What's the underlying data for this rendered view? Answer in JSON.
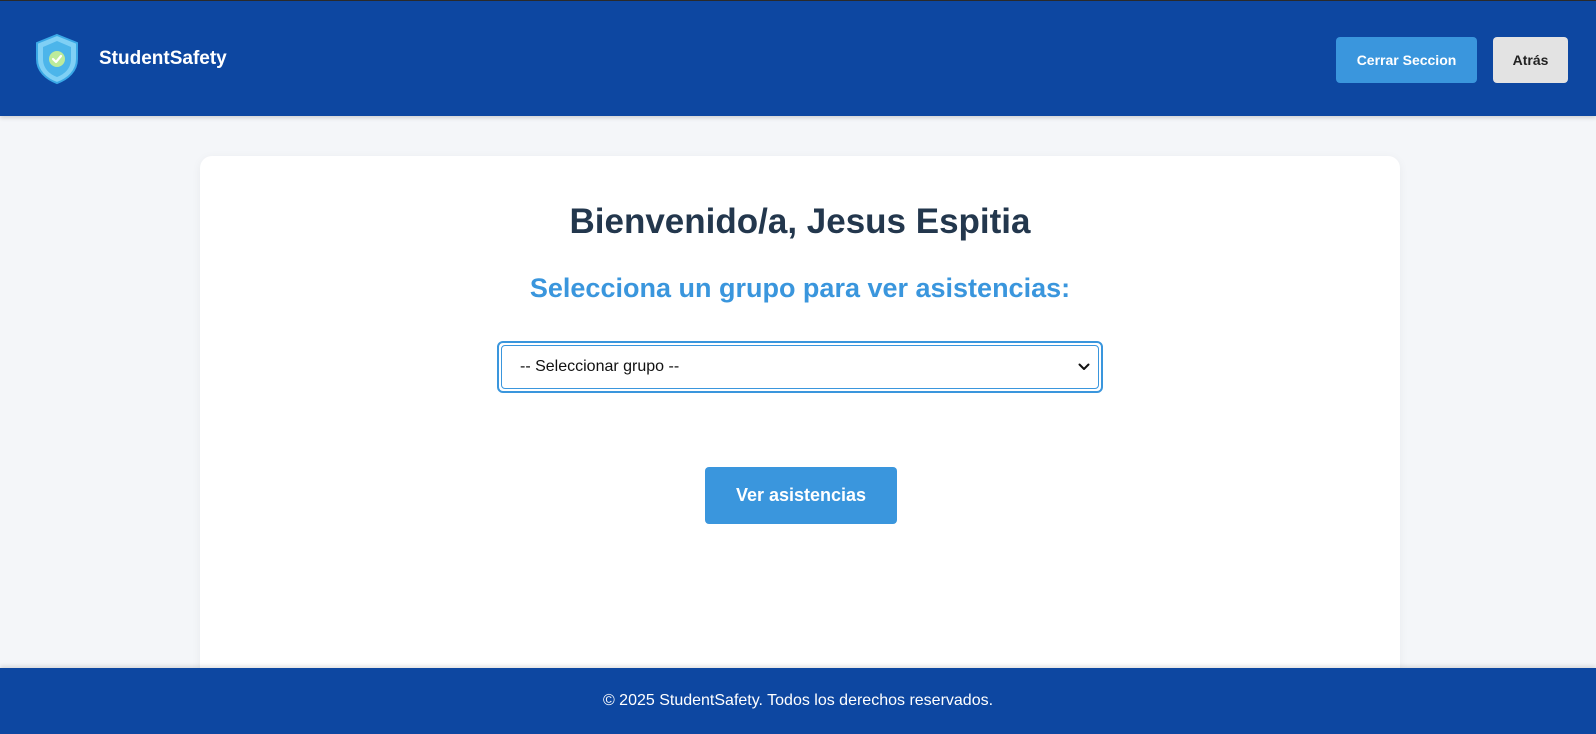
{
  "header": {
    "brand_name": "StudentSafety",
    "logout_label": "Cerrar Seccion",
    "back_label": "Atrás",
    "logo_icon": "shield-check-icon"
  },
  "main": {
    "welcome": "Bienvenido/a, Jesus Espitia",
    "subtitle": "Selecciona un grupo para ver asistencias:",
    "group_select": {
      "selected": "-- Seleccionar grupo --"
    },
    "view_button_label": "Ver asistencias"
  },
  "footer": {
    "text": "© 2025 StudentSafety. Todos los derechos reservados."
  },
  "colors": {
    "header_bg": "#0d47a1",
    "accent": "#3a96dd",
    "heading": "#23374d",
    "page_bg": "#f4f6f9"
  }
}
